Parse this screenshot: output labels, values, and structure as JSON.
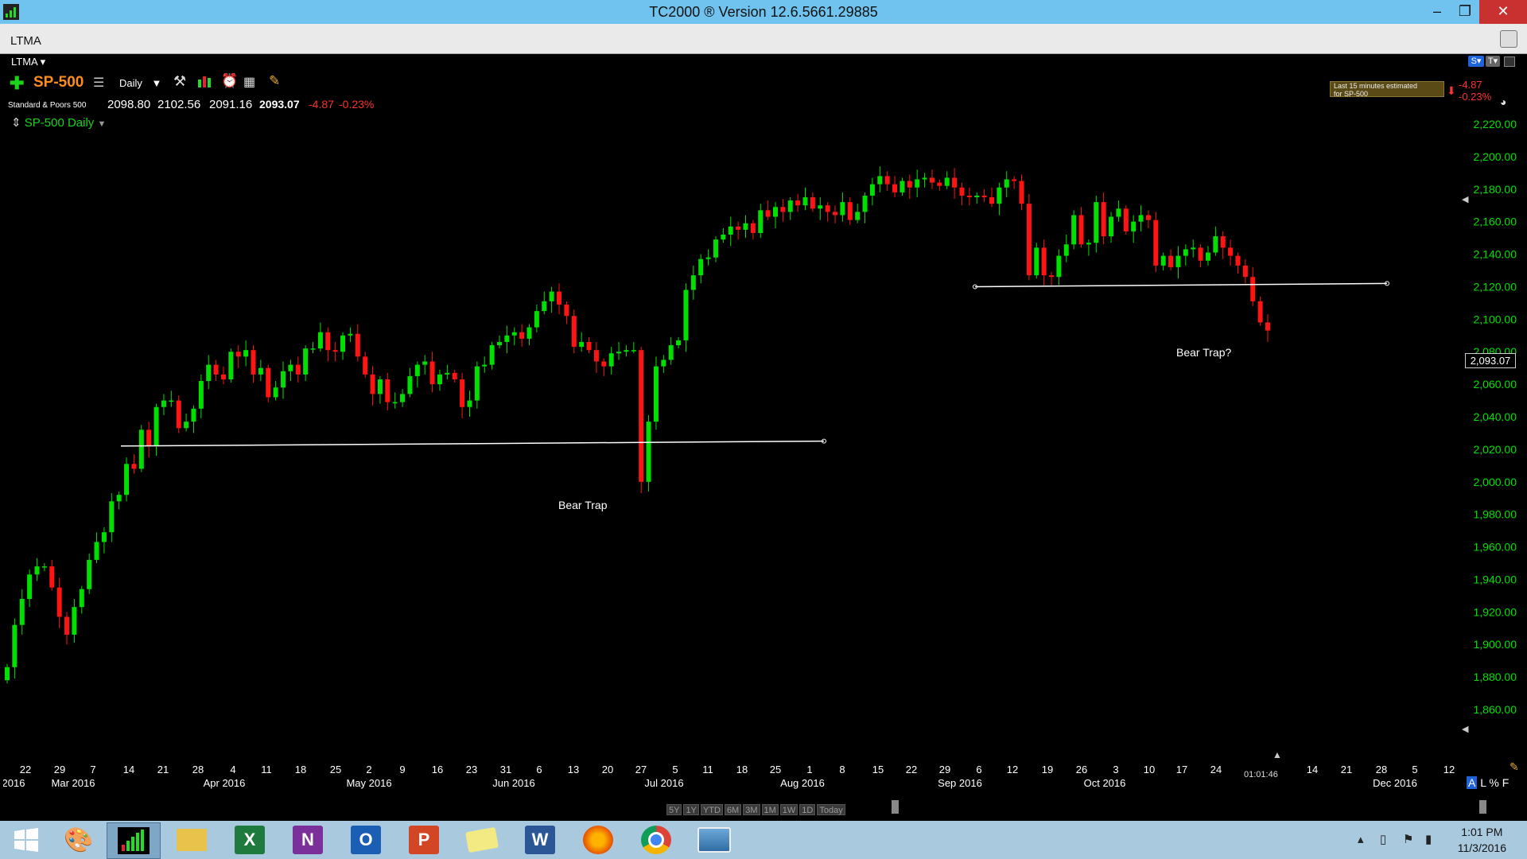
{
  "window": {
    "title": "TC2000 ® Version 12.6.5661.29885",
    "tab": "LTMA"
  },
  "layout_menu": "LTMA",
  "symbol": {
    "ticker": "SP-500",
    "name": "Standard & Poors 500",
    "timeframe": "Daily",
    "open": "2098.80",
    "high": "2102.56",
    "low": "2091.16",
    "close": "2093.07",
    "change": "-4.87",
    "pct_change": "-0.23%",
    "chart_label": "SP-500 Daily"
  },
  "delay_notice": {
    "line1": "Last 15 minutes estimated",
    "line2": "for SP-500"
  },
  "right_change": {
    "change": "-4.87",
    "pct": "-0.23%"
  },
  "price_label": "2,093.07",
  "countdown": "01:01:46",
  "annotations": [
    "Bear Trap",
    "Bear Trap?"
  ],
  "scale_buttons": [
    "A",
    "L",
    "%",
    "F"
  ],
  "view_buttons": [
    "5Y",
    "1Y",
    "YTD",
    "6M",
    "3M",
    "1M",
    "1W",
    "1D",
    "Today"
  ],
  "chart_data": {
    "type": "candlestick",
    "title": "SP-500 Daily",
    "ylim": [
      1860,
      2220
    ],
    "y_ticks": [
      "2,220.00",
      "2,200.00",
      "2,180.00",
      "2,160.00",
      "2,140.00",
      "2,120.00",
      "2,100.00",
      "2,080.00",
      "2,060.00",
      "2,040.00",
      "2,020.00",
      "2,000.00",
      "1,980.00",
      "1,960.00",
      "1,940.00",
      "1,920.00",
      "1,900.00",
      "1,880.00",
      "1,860.00"
    ],
    "x_day_ticks": [
      "22",
      "29",
      "7",
      "14",
      "21",
      "28",
      "4",
      "11",
      "18",
      "25",
      "2",
      "9",
      "16",
      "23",
      "31",
      "6",
      "13",
      "20",
      "27",
      "5",
      "11",
      "18",
      "25",
      "1",
      "8",
      "15",
      "22",
      "29",
      "6",
      "12",
      "19",
      "26",
      "3",
      "10",
      "17",
      "24",
      "14",
      "21",
      "28",
      "5",
      "12"
    ],
    "x_month_ticks": [
      "2016",
      "Mar 2016",
      "Apr 2016",
      "May 2016",
      "Jun 2016",
      "Jul 2016",
      "Aug 2016",
      "Sep 2016",
      "Oct 2016",
      "Dec 2016"
    ],
    "colors": {
      "up": "#00e000",
      "down": "#ff1414",
      "grid": "none",
      "trendline": "#ffffff",
      "axis_text": "#00e000"
    },
    "closes": [
      1886,
      1912,
      1928,
      1943,
      1948,
      1948,
      1935,
      1917,
      1906,
      1923,
      1934,
      1952,
      1963,
      1969,
      1988,
      1992,
      2011,
      2008,
      2032,
      2022,
      2046,
      2050,
      2050,
      2033,
      2037,
      2045,
      2062,
      2072,
      2066,
      2063,
      2080,
      2077,
      2081,
      2066,
      2070,
      2052,
      2058,
      2068,
      2072,
      2066,
      2082,
      2082,
      2092,
      2081,
      2080,
      2090,
      2091,
      2077,
      2066,
      2054,
      2063,
      2049,
      2049,
      2054,
      2065,
      2072,
      2074,
      2060,
      2066,
      2067,
      2063,
      2046,
      2050,
      2071,
      2072,
      2084,
      2086,
      2090,
      2092,
      2088,
      2095,
      2105,
      2111,
      2117,
      2109,
      2102,
      2083,
      2086,
      2081,
      2074,
      2071,
      2079,
      2080,
      2081,
      2081,
      2000,
      2037,
      2071,
      2075,
      2084,
      2087,
      2118,
      2127,
      2137,
      2138,
      2149,
      2152,
      2157,
      2155,
      2159,
      2153,
      2167,
      2163,
      2169,
      2166,
      2173,
      2170,
      2175,
      2168,
      2170,
      2166,
      2164,
      2172,
      2161,
      2166,
      2176,
      2183,
      2188,
      2183,
      2178,
      2185,
      2181,
      2186,
      2187,
      2184,
      2182,
      2187,
      2181,
      2176,
      2175,
      2176,
      2175,
      2171,
      2181,
      2186,
      2185,
      2171,
      2127,
      2144,
      2127,
      2126,
      2139,
      2146,
      2164,
      2146,
      2147,
      2172,
      2151,
      2163,
      2168,
      2154,
      2160,
      2164,
      2161,
      2133,
      2139,
      2132,
      2139,
      2143,
      2144,
      2136,
      2141,
      2151,
      2144,
      2139,
      2133,
      2126,
      2111,
      2098,
      2093
    ],
    "trendlines": [
      {
        "from": [
          "Mar 2016",
          2022
        ],
        "to": [
          "Aug 2016",
          2025
        ]
      },
      {
        "from": [
          "Sep 2016",
          2120
        ],
        "to": [
          "Nov 2016",
          2122
        ]
      }
    ]
  }
}
